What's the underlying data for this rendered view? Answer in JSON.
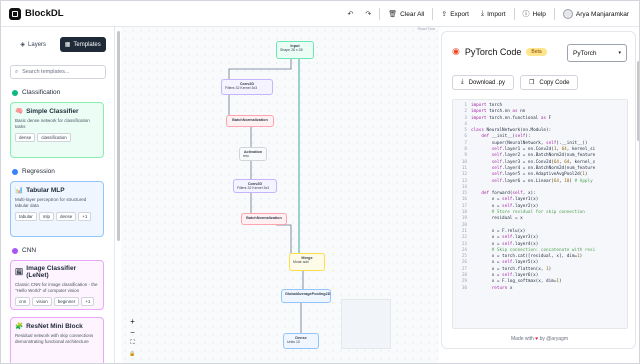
{
  "app": {
    "name": "BlockDL"
  },
  "header": {
    "buttons": [
      {
        "label": "Clear All",
        "icon": "trash-icon"
      },
      {
        "label": "Export",
        "icon": "export-icon"
      },
      {
        "label": "Import",
        "icon": "import-icon"
      },
      {
        "label": "Help",
        "icon": "help-icon"
      }
    ],
    "user": "Arya Manjaramkar"
  },
  "sidebar": {
    "tabs": [
      {
        "label": "Layers",
        "active": false
      },
      {
        "label": "Templates",
        "active": true
      }
    ],
    "search_placeholder": "Search templates...",
    "categories": [
      {
        "label": "Classification",
        "color": "#10b981"
      },
      {
        "label": "Regression",
        "color": "#3b82f6"
      },
      {
        "label": "CNN",
        "color": "#a855f7"
      }
    ],
    "templates": [
      {
        "title": "Simple Classifier",
        "desc": "Basic dense network for classification tasks",
        "tags": [
          "dense",
          "classification"
        ]
      },
      {
        "title": "Tabular MLP",
        "desc": "Multi-layer perceptron for structured tabular data",
        "tags": [
          "tabular",
          "mlp",
          "dense",
          "+1"
        ]
      },
      {
        "title": "Image Classifier (LeNet)",
        "desc": "Classic CNN for image classification - the \"Hello World\" of computer vision",
        "tags": [
          "cnn",
          "vision",
          "beginner",
          "+1"
        ]
      },
      {
        "title": "ResNet Mini Block",
        "desc": "Residual network with skip connections demonstrating functional architecture",
        "tags": []
      }
    ]
  },
  "canvas": {
    "nodes": [
      {
        "title": "Input",
        "sub": "Shape  28  x 28"
      },
      {
        "title": "Conv2D",
        "sub": "Filters  32   Kernel  3x3"
      },
      {
        "title": "BatchNormalization",
        "sub": ""
      },
      {
        "title": "Activation",
        "sub": "relu"
      },
      {
        "title": "Conv2D",
        "sub": "Filters  32   Kernel  3x3"
      },
      {
        "title": "BatchNormalization",
        "sub": ""
      },
      {
        "title": "Merge",
        "sub": "Mode  add"
      },
      {
        "title": "GlobalAveragePooling2D",
        "sub": ""
      },
      {
        "title": "Dense",
        "sub": "Units  10"
      }
    ],
    "attribution": "React Flow",
    "zoom_controls": [
      "+",
      "−",
      "⛶",
      "🔒"
    ]
  },
  "code_panel": {
    "title": "PyTorch Code",
    "badge": "Beta",
    "framework": "PyTorch",
    "actions": [
      {
        "label": "Download .py",
        "icon": "download-icon"
      },
      {
        "label": "Copy Code",
        "icon": "copy-icon"
      }
    ],
    "lines": [
      "import torch",
      "import torch.nn as nn",
      "import torch.nn.functional as F",
      "",
      "class NeuralNetwork(nn.Module):",
      "    def __init__(self):",
      "        super(NeuralNetwork, self).__init__()",
      "        self.layer1 = nn.Conv2d(1, 64, kernel_si",
      "        self.layer2 = nn.BatchNorm2d(num_feature",
      "        self.layer3 = nn.Conv2d(64, 64, kernel_s",
      "        self.layer4 = nn.BatchNorm2d(num_feature",
      "        self.layer5 = nn.AdaptiveAvgPool2d(1)",
      "        self.layer6 = nn.Linear(64, 10) # Apply",
      "",
      "    def forward(self, x):",
      "        x = self.layer1(x)",
      "        x = self.layer2(x)",
      "        # Store residual for skip connection",
      "        residual = x",
      "",
      "        x = F.relu(x)",
      "        x = self.layer3(x)",
      "        x = self.layer4(x)",
      "        # Skip connection: concatenate with resi",
      "        x = torch.cat([residual, x], dim=1)",
      "        x = self.layer5(x)",
      "        x = torch.flatten(x, 1)",
      "        x = self.layer6(x)",
      "        x = F.log_softmax(x, dim=1)",
      "        return x"
    ],
    "footer_pre": "Made with",
    "footer_post": "by @aryagm"
  }
}
